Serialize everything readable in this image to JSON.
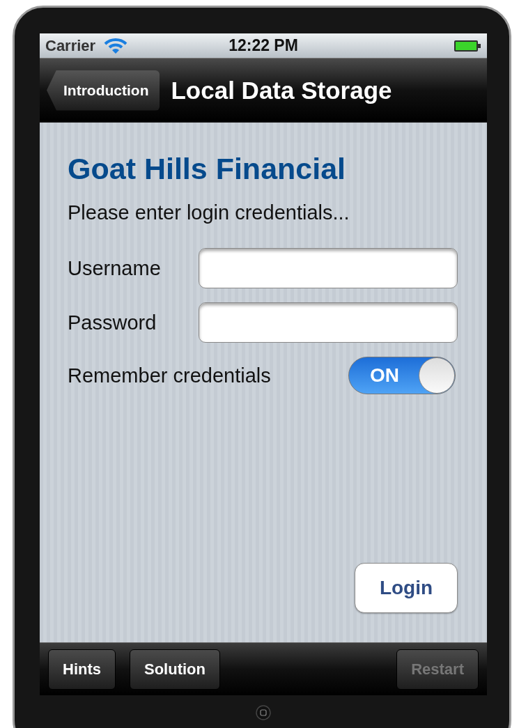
{
  "status_bar": {
    "carrier": "Carrier",
    "time": "12:22 PM"
  },
  "nav_bar": {
    "back_button": "Introduction",
    "title": "Local Data Storage"
  },
  "content": {
    "heading": "Goat Hills Financial",
    "prompt": "Please enter login credentials...",
    "fields": [
      {
        "label": "Username"
      },
      {
        "label": "Password"
      }
    ],
    "remember": {
      "label": "Remember credentials",
      "on": true,
      "on_text": "ON"
    },
    "login_button": "Login"
  },
  "toolbar": [
    {
      "label": "Hints",
      "disabled": false
    },
    {
      "label": "Solution",
      "disabled": false
    },
    {
      "label": "Restart",
      "disabled": true
    }
  ]
}
